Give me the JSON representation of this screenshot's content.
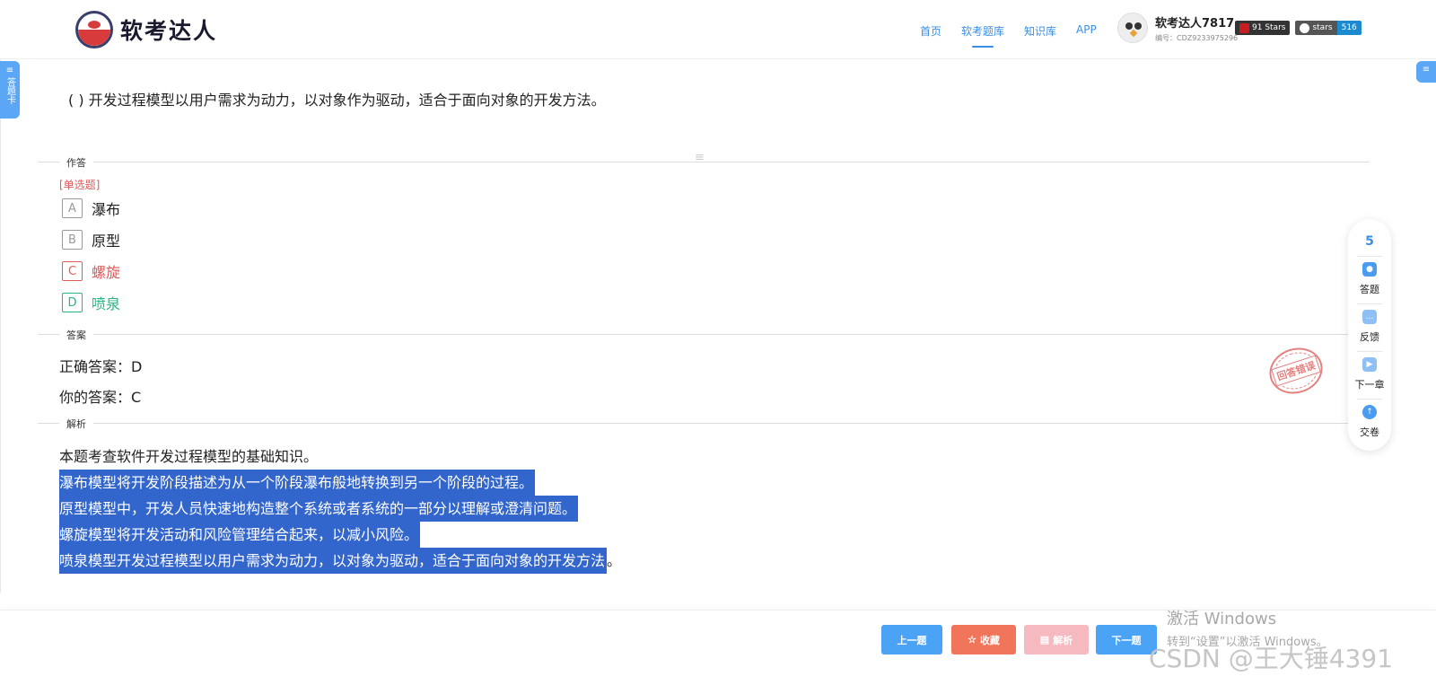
{
  "header": {
    "logo_text": "软考达人",
    "nav": [
      "首页",
      "软考题库",
      "知识库",
      "APP"
    ],
    "user_name": "软考达人7817",
    "user_id": "编号：CDZ9233975296",
    "badges": [
      {
        "left": "91 Stars",
        "right": ""
      },
      {
        "left": "stars",
        "right": "516"
      }
    ]
  },
  "side_tab": {
    "lines": "≡",
    "label": "答题卡"
  },
  "right_tab": {
    "label": "≡"
  },
  "question": {
    "text": "( ) 开发过程模型以用户需求为动力，以对象作为驱动，适合于面向对象的开发方法。",
    "type": "[单选题]",
    "options": [
      {
        "key": "A",
        "text": "瀑布"
      },
      {
        "key": "B",
        "text": "原型"
      },
      {
        "key": "C",
        "text": "螺旋"
      },
      {
        "key": "D",
        "text": "喷泉"
      }
    ]
  },
  "sections": {
    "answer_area": "作答",
    "answer": "答案",
    "analysis": "解析"
  },
  "answer": {
    "correct": "正确答案：D",
    "yours": "你的答案：C",
    "stamp": "回答错误"
  },
  "analysis": {
    "intro": "本题考查软件开发过程模型的基础知识。",
    "lines": [
      "瀑布模型将开发阶段描述为从一个阶段瀑布般地转换到另一个阶段的过程。",
      "原型模型中，开发人员快速地构造整个系统或者系统的一部分以理解或澄清问题。",
      "螺旋模型将开发活动和风险管理结合起来，以减小风险。",
      "喷泉模型开发过程模型以用户需求为动力，以对象为驱动，适合于面向对象的开发方法"
    ],
    "tail": "。"
  },
  "toolbar": {
    "count": "5",
    "items": [
      {
        "icon": "answer-icon",
        "label": "答题"
      },
      {
        "icon": "feedback-icon",
        "label": "反馈"
      },
      {
        "icon": "next-chapter-icon",
        "label": "下一章"
      },
      {
        "icon": "submit-icon",
        "label": "交卷"
      }
    ]
  },
  "bottom": {
    "prev": "上一题",
    "favorite": "收藏",
    "analysis": "解析",
    "next": "下一题"
  },
  "watermarks": {
    "win1": "激活 Windows",
    "win2": "转到“设置”以激活 Windows。",
    "csdn": "CSDN @王大锤4391"
  },
  "colors": {
    "accent": "#3a8ee6",
    "wrong": "#e05a5a",
    "right": "#2bb580",
    "highlight": "#3366cc"
  }
}
